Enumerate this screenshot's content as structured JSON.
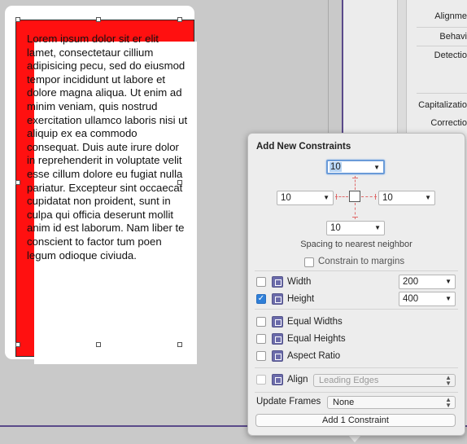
{
  "canvas": {
    "text_content": "Lorem ipsum dolor sit er elit lamet, consectetaur cillium adipisicing pecu, sed do eiusmod tempor incididunt ut labore et dolore magna aliqua. Ut enim ad minim veniam, quis nostrud exercitation ullamco laboris nisi ut aliquip ex ea commodo consequat. Duis aute irure dolor in reprehenderit in voluptate velit esse cillum dolore eu fugiat nulla pariatur. Excepteur sint occaecat cupidatat non proident, sunt in culpa qui officia deserunt mollit anim id est laborum. Nam liber te conscient to factor tum poen legum odioque civiuda."
  },
  "inspector": {
    "labels": [
      "Alignme",
      "Behavi",
      "Detectio",
      "Capitalizatio",
      "Correctio"
    ]
  },
  "popover": {
    "title": "Add New Constraints",
    "spacing": {
      "top": "10",
      "left": "10",
      "right": "10",
      "bottom": "10"
    },
    "spacing_label": "Spacing to nearest neighbor",
    "constrain_to_margins": {
      "label": "Constrain to margins",
      "checked": false
    },
    "width": {
      "label": "Width",
      "checked": false,
      "value": "200"
    },
    "height": {
      "label": "Height",
      "checked": true,
      "value": "400"
    },
    "equal_widths": {
      "label": "Equal Widths",
      "checked": false
    },
    "equal_heights": {
      "label": "Equal Heights",
      "checked": false
    },
    "aspect_ratio": {
      "label": "Aspect Ratio",
      "checked": false
    },
    "align": {
      "label": "Align",
      "checked": false,
      "value": "Leading Edges"
    },
    "update_frames": {
      "label": "Update Frames",
      "value": "None"
    },
    "add_button": "Add 1 Constraint"
  },
  "colors": {
    "textview_background": "#ff1010",
    "checkbox_checked": "#2f7fd8",
    "constraint_icon": "#6b6baa",
    "window_border": "#5a4a8a"
  }
}
